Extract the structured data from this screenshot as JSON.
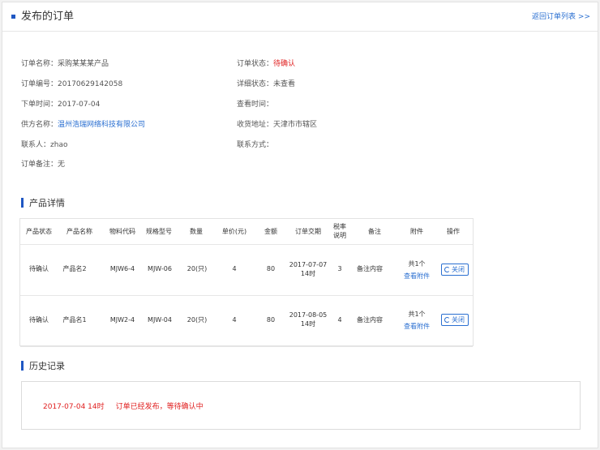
{
  "header": {
    "title": "发布的订单",
    "back_link": "返回订单列表 >>"
  },
  "order": {
    "name": {
      "label": "订单名称：",
      "value": "采购某某某产品"
    },
    "number": {
      "label": "订单编号：",
      "value": "20170629142058"
    },
    "time": {
      "label": "下单时间：",
      "value": "2017-07-04"
    },
    "supplier": {
      "label": "供方名称：",
      "value": "温州浩瑞网络科技有限公司"
    },
    "contact": {
      "label": "联系人：",
      "value": "zhao"
    },
    "remark": {
      "label": "订单备注：",
      "value": "无"
    },
    "status": {
      "label": "订单状态：",
      "value": "待确认"
    },
    "detail_status": {
      "label": "详细状态：",
      "value": "未查看"
    },
    "view_time": {
      "label": "查看时间：",
      "value": ""
    },
    "address": {
      "label": "收货地址：",
      "value": "天津市市辖区"
    },
    "contact_method": {
      "label": "联系方式：",
      "value": ""
    }
  },
  "products": {
    "title": "产品详情",
    "columns": [
      "产品状态",
      "产品名称",
      "物料代码",
      "规格型号",
      "数量",
      "单价(元)",
      "金额",
      "订单交期",
      "税率",
      "说明",
      "备注",
      "附件",
      "操作"
    ],
    "rows": [
      {
        "status": "待确认",
        "name": "产品名2",
        "code": "MJW6-4",
        "spec": "MJW-06",
        "qty": "20(只)",
        "price": "4",
        "amount": "80",
        "date": "2017-07-07",
        "time": "14时",
        "tax": "3",
        "remark": "备注内容",
        "attach_count": "共1个",
        "attach_link": "查看附件",
        "action": "关闭"
      },
      {
        "status": "待确认",
        "name": "产品名1",
        "code": "MJW2-4",
        "spec": "MJW-04",
        "qty": "20(只)",
        "price": "4",
        "amount": "80",
        "date": "2017-08-05",
        "time": "14时",
        "tax": "4",
        "remark": "备注内容",
        "attach_count": "共1个",
        "attach_link": "查看附件",
        "action": "关闭"
      }
    ]
  },
  "history": {
    "title": "历史记录",
    "entries": [
      {
        "time": "2017-07-04 14时",
        "text": "订单已经发布，等待确认中"
      }
    ]
  },
  "colors": {
    "accent": "#1f57c3",
    "link": "#2a6fd1",
    "alert": "#e02020"
  }
}
